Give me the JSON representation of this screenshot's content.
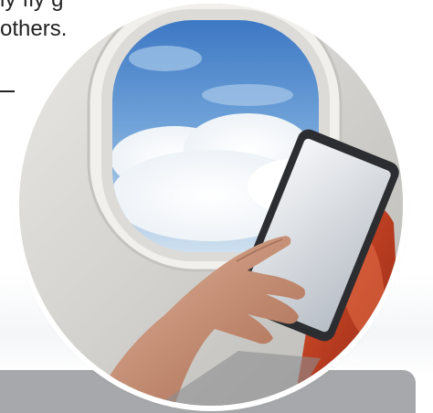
{
  "text": {
    "line1": "ly fly g",
    "line2": "others."
  },
  "image": {
    "alt": "Passenger using a tablet beside an airplane window",
    "subject": "airplane-window-tablet-photo"
  },
  "colors": {
    "panel": "#a7a8ab",
    "sky": "#4f86c9",
    "seat_red": "#c33a1f",
    "cabin_wall": "#cfcfcb"
  }
}
